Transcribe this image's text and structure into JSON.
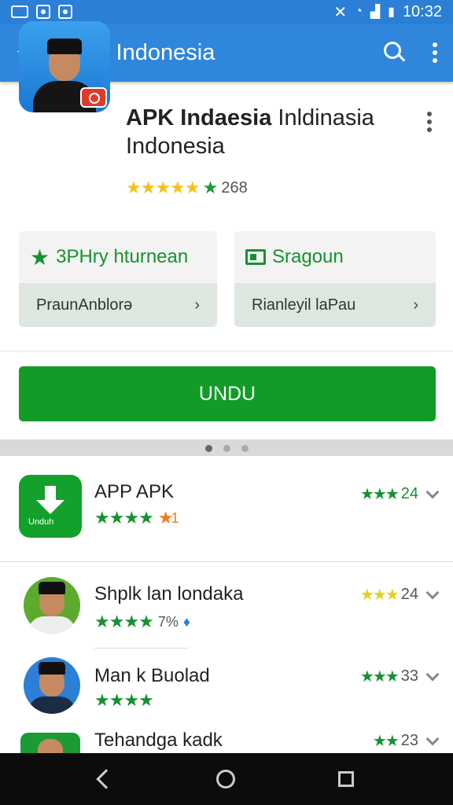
{
  "status_bar": {
    "time": "10:32"
  },
  "app_bar": {
    "title": "APP Indonesia"
  },
  "featured": {
    "title_bold": "APK Indaesia",
    "title_rest": " Inldinasia",
    "title_line2": "Indonesia",
    "rating_count": "268",
    "rating_stars": "★★★★★",
    "panel_left": {
      "top_label": "3PHry hturnean",
      "bottom_label": "PraunAnblorə"
    },
    "panel_right": {
      "top_label": "Sragoun",
      "bottom_label": "Rianleyil laPau"
    },
    "download_label": "UNDU"
  },
  "list": [
    {
      "name": "APP APK",
      "stars": "★★★★",
      "half": "★",
      "extra": "1",
      "right_value": "24"
    },
    {
      "name": "Shplk lan londaka",
      "stars": "★★★★",
      "extra": "7%",
      "right_value": "24"
    },
    {
      "name": "Man k Buolad",
      "stars": "★★★★",
      "extra": "",
      "right_value": "33"
    },
    {
      "name": "Tehandga kadk",
      "stars": "",
      "extra": "",
      "right_value": "23"
    }
  ],
  "icon_text": {
    "download_tile": "Unduh"
  },
  "colors": {
    "app_bar": "#2f86dc",
    "primary_green": "#139b27",
    "nav_bar": "#0c0c0c"
  }
}
